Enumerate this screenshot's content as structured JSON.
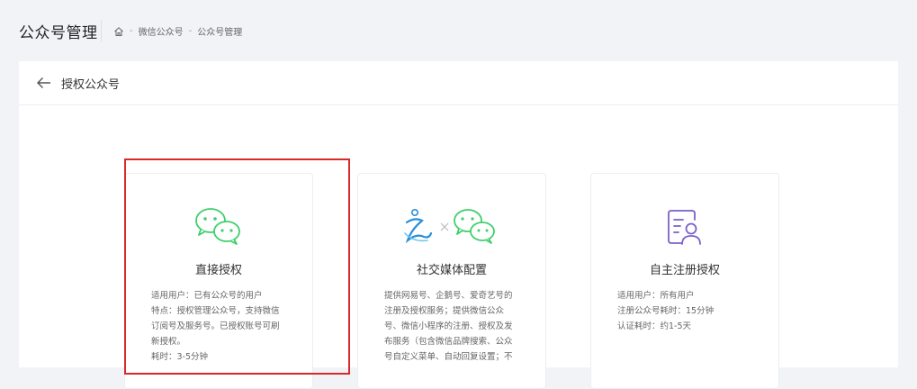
{
  "header": {
    "title": "公众号管理",
    "breadcrumb": [
      "微信公众号",
      "公众号管理"
    ],
    "separator": "-"
  },
  "panel": {
    "title": "授权公众号"
  },
  "cards": [
    {
      "title": "直接授权",
      "desc": [
        "适用用户：已有公众号的用户",
        "特点：授权管理公众号，支持微信",
        "订阅号及服务号。已授权账号可刷",
        "新授权。",
        "耗时：3-5分钟"
      ],
      "icon": "wechat-icon",
      "selected": true
    },
    {
      "title": "社交媒体配置",
      "desc": [
        "提供网易号、企鹅号、爱奇艺号的",
        "注册及授权服务；提供微信公众",
        "号、微信小程序的注册、授权及发",
        "布服务（包含微信品牌搜索、公众",
        "号自定义菜单、自动回复设置；不"
      ],
      "icon": "social-media-icon",
      "selected": false
    },
    {
      "title": "自主注册授权",
      "desc": [
        "适用用户：所有用户",
        "注册公众号耗时：15分钟",
        "认证耗时：约1-5天"
      ],
      "icon": "register-profile-icon",
      "selected": false
    }
  ],
  "colors": {
    "accent_green": "#3ecf6b",
    "accent_purple": "#7b61c8",
    "highlight_red": "#d92a2a"
  }
}
